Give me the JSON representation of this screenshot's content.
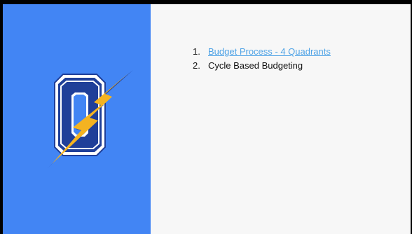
{
  "logo": {
    "icon": "o-lightning-bolt-logo",
    "colors": {
      "letter": "#1f3f99",
      "outline": "#ffffff",
      "bolt": "#f4b321",
      "panel": "#4285f4"
    }
  },
  "agenda": {
    "items": [
      {
        "number": "1.",
        "label": "Budget Process - 4 Quadrants",
        "is_link": true
      },
      {
        "number": "2.",
        "label": "Cycle Based Budgeting",
        "is_link": false
      }
    ]
  }
}
